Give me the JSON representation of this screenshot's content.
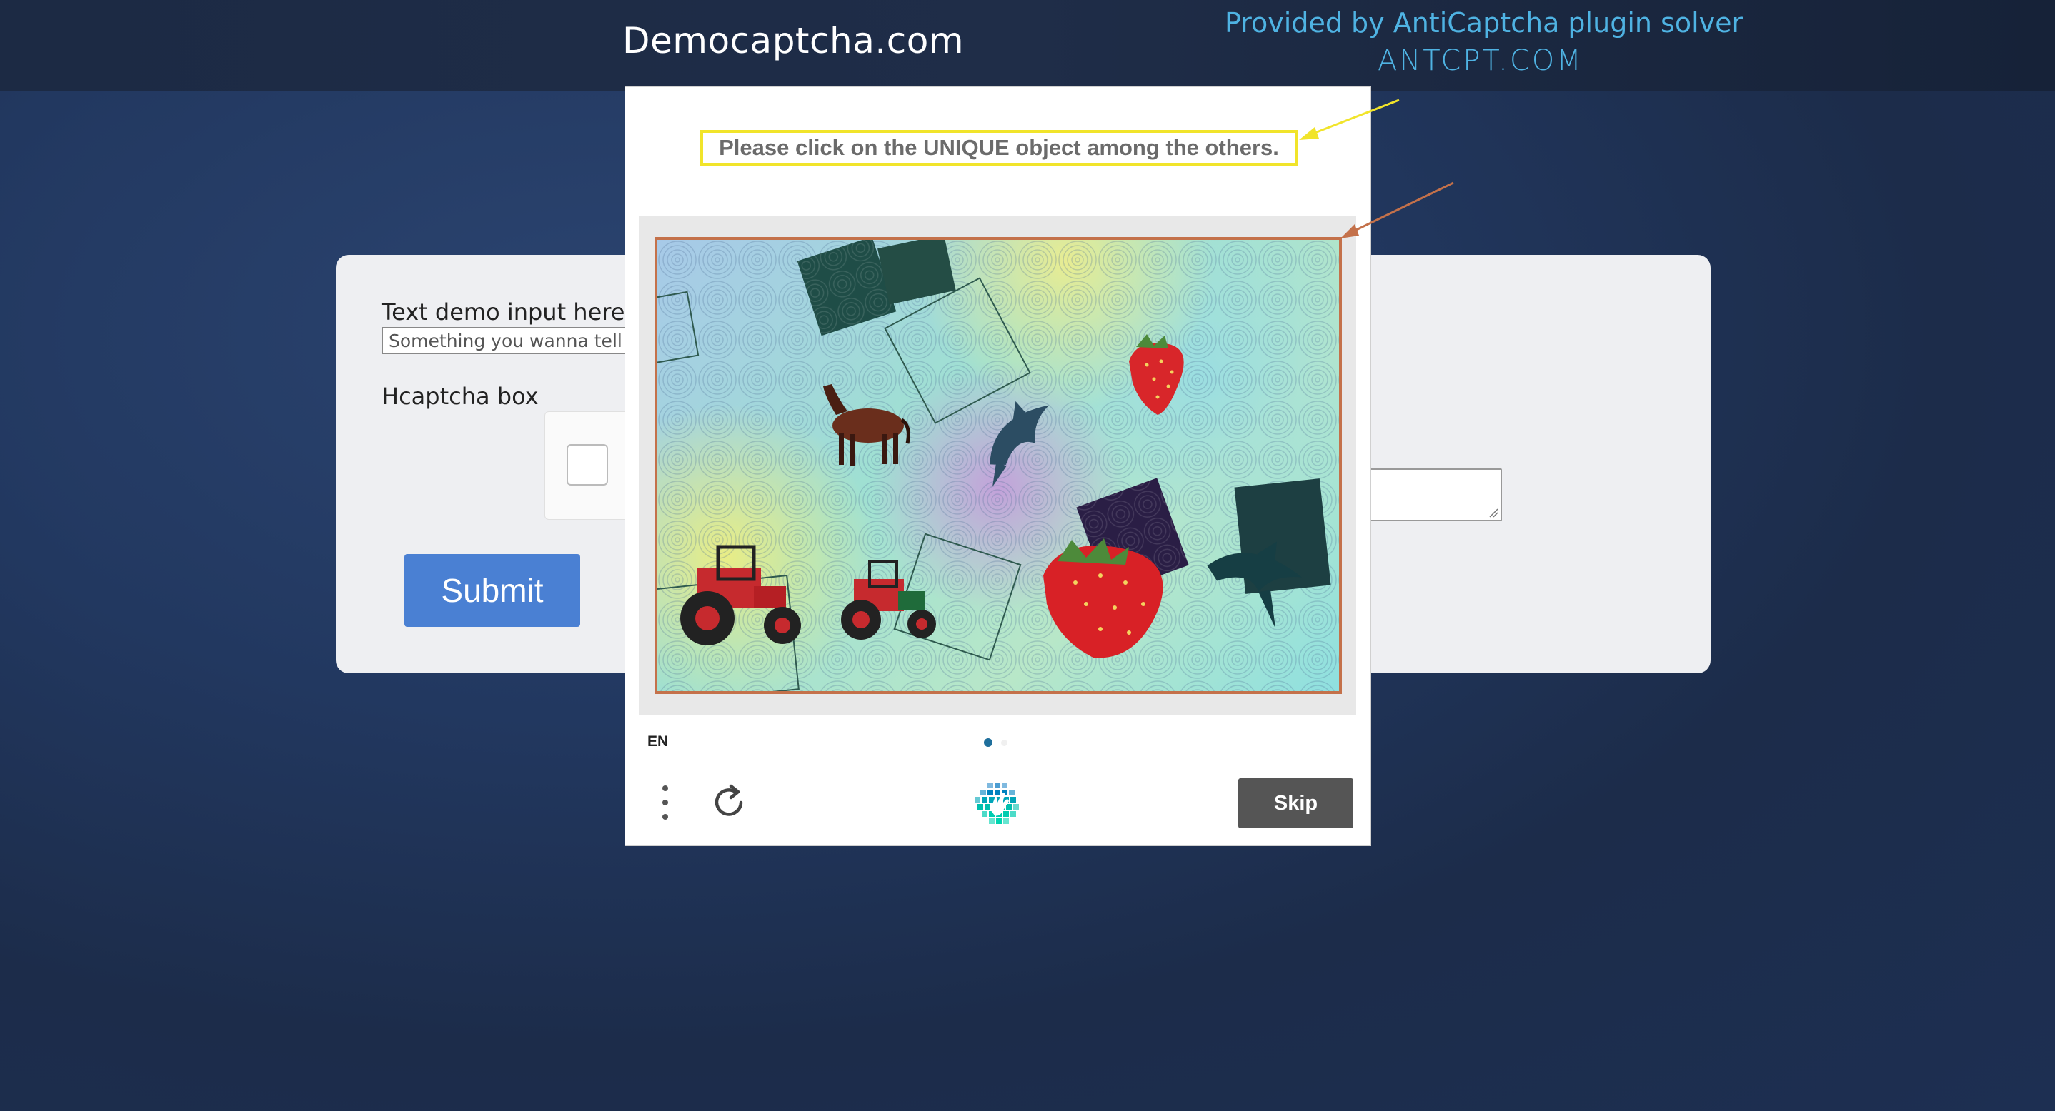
{
  "header": {
    "site_title": "Democaptcha.com",
    "provided_by": "Provided by AntiCaptcha plugin solver",
    "antcpt": "ANTCPT.COM"
  },
  "form": {
    "text_label": "Text demo input here",
    "text_value": "Something you wanna tell th",
    "hcaptcha_label": "Hcaptcha box",
    "submit_label": "Submit"
  },
  "challenge": {
    "prompt": "Please click on the UNIQUE object among the others.",
    "language": "EN",
    "skip_label": "Skip",
    "page_indicator": {
      "current": 1,
      "total": 2
    },
    "image_objects": [
      "horse-icon",
      "dolphin-icon",
      "dolphin-icon",
      "strawberry-icon",
      "strawberry-icon",
      "tractor-icon",
      "tractor-icon"
    ],
    "colors": {
      "prompt_highlight": "#f1e42a",
      "image_highlight": "#c4714a",
      "skip_bg": "#555555",
      "active_dot": "#1f6f9c"
    }
  },
  "colors": {
    "accent_text": "#4fb3e3",
    "submit_bg": "#4a80d3"
  }
}
